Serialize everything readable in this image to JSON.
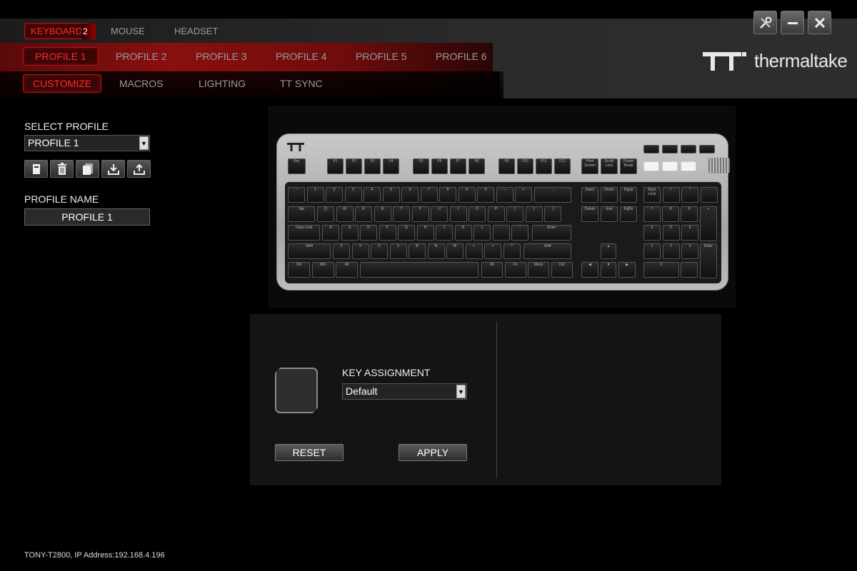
{
  "devices": {
    "keyboard": "KEYBOARD",
    "badge": "2",
    "mouse": "MOUSE",
    "headset": "HEADSET"
  },
  "profiles": [
    "PROFILE 1",
    "PROFILE 2",
    "PROFILE 3",
    "PROFILE 4",
    "PROFILE 5",
    "PROFILE 6"
  ],
  "sub_tabs": [
    "CUSTOMIZE",
    "MACROS",
    "LIGHTING",
    "TT SYNC"
  ],
  "brand": {
    "logo_text": "thermaltake",
    "accent": "#ff2a2a"
  },
  "window": {
    "settings_icon": "wrench-screwdriver-icon",
    "minimize_icon": "minimize-icon",
    "close_icon": "close-icon"
  },
  "left": {
    "select_profile_label": "SELECT PROFILE",
    "select_profile_value": "PROFILE 1",
    "tools": [
      "new-profile-icon",
      "delete-icon",
      "copy-icon",
      "import-icon",
      "export-icon"
    ],
    "profile_name_label": "PROFILE NAME",
    "profile_name_value": "PROFILE 1"
  },
  "keyboard_keys": {
    "esc": "Esc",
    "f": [
      "F1",
      "F2",
      "F3",
      "F4",
      "F5",
      "F6",
      "F7",
      "F8",
      "F9",
      "F10",
      "F11",
      "F12"
    ],
    "sys": [
      "Print Screen",
      "Scroll Lock",
      "Pause Break"
    ],
    "num_row": [
      "~",
      "1",
      "2",
      "3",
      "4",
      "5",
      "6",
      "7",
      "8",
      "9",
      "0",
      "–",
      "="
    ],
    "backspace": "←",
    "nav1": [
      "Insert",
      "Home",
      "PgUp"
    ],
    "numpad1": [
      "Num Lock",
      "/",
      "*",
      "-"
    ],
    "tab": "Tab",
    "q_row": [
      "Q",
      "W",
      "E",
      "R",
      "T",
      "Y",
      "U",
      "I",
      "O",
      "P",
      "{",
      "}",
      "|"
    ],
    "nav2": [
      "Delete",
      "End",
      "PgDn"
    ],
    "numpad2": [
      "7",
      "8",
      "9",
      "+"
    ],
    "caps": "Caps Lock",
    "a_row": [
      "A",
      "S",
      "D",
      "F",
      "G",
      "H",
      "J",
      "K",
      "L",
      ":",
      "\""
    ],
    "enter": "Enter",
    "numpad3": [
      "4",
      "5",
      "6"
    ],
    "shift": "Shift",
    "z_row": [
      "Z",
      "X",
      "C",
      "V",
      "B",
      "N",
      "M",
      "<",
      ">",
      "?"
    ],
    "numpad4": [
      "1",
      "2",
      "3",
      "Enter"
    ],
    "bottom_left": [
      "Ctrl",
      "Win",
      "Alt"
    ],
    "bottom_right": [
      "Alt",
      "Fn",
      "Menu",
      "Ctrl"
    ],
    "numpad5": [
      "0",
      "."
    ]
  },
  "assignment": {
    "label": "KEY ASSIGNMENT",
    "value": "Default",
    "reset": "RESET",
    "apply": "APPLY"
  },
  "status": "TONY-T2800, IP Address:192.168.4.196"
}
